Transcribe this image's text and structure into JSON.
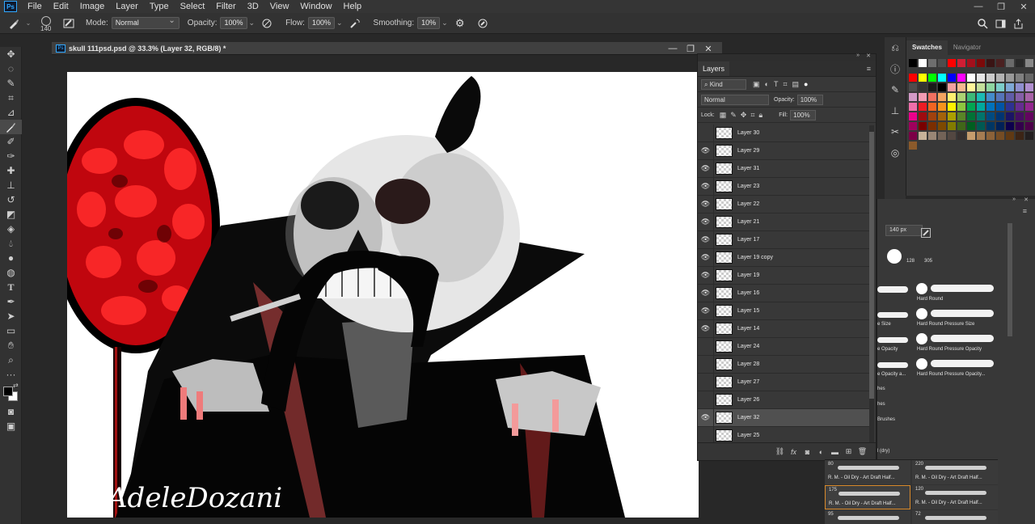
{
  "menubar": {
    "logo": "Ps",
    "items": [
      "File",
      "Edit",
      "Image",
      "Layer",
      "Type",
      "Select",
      "Filter",
      "3D",
      "View",
      "Window",
      "Help"
    ]
  },
  "options": {
    "brush_size": "140",
    "mode_label": "Mode:",
    "mode_value": "Normal",
    "opacity_label": "Opacity:",
    "opacity_value": "100%",
    "flow_label": "Flow:",
    "flow_value": "100%",
    "smoothing_label": "Smoothing:",
    "smoothing_value": "10%"
  },
  "document": {
    "title": "skull 111psd.psd @ 33.3% (Layer 32, RGB/8) *",
    "signature": "AdeleDozani"
  },
  "layers_panel": {
    "tab": "Layers",
    "kind_label": "Kind",
    "blend_mode": "Normal",
    "opacity_label": "Opacity:",
    "opacity_value": "100%",
    "lock_label": "Lock:",
    "fill_label": "Fill:",
    "fill_value": "100%",
    "layers": [
      {
        "name": "Layer 30",
        "visible": false
      },
      {
        "name": "Layer 29",
        "visible": true
      },
      {
        "name": "Layer 31",
        "visible": true
      },
      {
        "name": "Layer 23",
        "visible": true
      },
      {
        "name": "Layer 22",
        "visible": true
      },
      {
        "name": "Layer 21",
        "visible": true
      },
      {
        "name": "Layer 17",
        "visible": true
      },
      {
        "name": "Layer 19 copy",
        "visible": true
      },
      {
        "name": "Layer 19",
        "visible": true
      },
      {
        "name": "Layer 16",
        "visible": true
      },
      {
        "name": "Layer 15",
        "visible": true
      },
      {
        "name": "Layer 14",
        "visible": true
      },
      {
        "name": "Layer 24",
        "visible": false
      },
      {
        "name": "Layer 28",
        "visible": false
      },
      {
        "name": "Layer 27",
        "visible": false
      },
      {
        "name": "Layer 26",
        "visible": false
      },
      {
        "name": "Layer 32",
        "visible": true,
        "selected": true
      },
      {
        "name": "Layer 25",
        "visible": false
      }
    ]
  },
  "swatches_panel": {
    "tabs": [
      "Swatches",
      "Navigator"
    ],
    "rows": [
      [
        "#000000",
        "#ffffff",
        "#6e6e6e",
        "#4d4d4d",
        "#ff0000",
        "#d01e34",
        "#a3101c",
        "#7d0a0a",
        "#3a1414",
        "#4a2020",
        "#6a6a6a",
        "#2a2a2a",
        "#888888"
      ],
      [
        "#ff0000",
        "#ffff00",
        "#00ff00",
        "#00ffff",
        "#0000ff",
        "#ff00ff",
        "#ffffff",
        "#e6e6e6",
        "#cccccc",
        "#b3b3b3",
        "#999999",
        "#808080",
        "#666666"
      ],
      [
        "#4d4d4d",
        "#333333",
        "#1a1a1a",
        "#000000",
        "#f2a0a0",
        "#f5b98f",
        "#fff59a",
        "#c4df9b",
        "#8ed6a1",
        "#7ccdca",
        "#7ea8d6",
        "#8f8fcf",
        "#b08fcf"
      ],
      [
        "#d39ac7",
        "#f29bb3",
        "#f07060",
        "#f4a460",
        "#fff170",
        "#acd373",
        "#3cb878",
        "#1cbbb4",
        "#448ccb",
        "#5574b9",
        "#605ca8",
        "#855fa8",
        "#a763a8"
      ],
      [
        "#f06eaa",
        "#ed1c24",
        "#f26522",
        "#f7941d",
        "#fff200",
        "#8dc63f",
        "#00a651",
        "#00a99d",
        "#0072bc",
        "#0054a6",
        "#2e3192",
        "#662d91",
        "#92278f"
      ],
      [
        "#ec008c",
        "#9e0b0f",
        "#a0410d",
        "#a3620a",
        "#aba000",
        "#598527",
        "#007236",
        "#00746b",
        "#004a80",
        "#003471",
        "#1b1464",
        "#440e62",
        "#630460"
      ],
      [
        "#9e005d",
        "#790000",
        "#7b2e00",
        "#7d4900",
        "#827b00",
        "#406618",
        "#005e20",
        "#005952",
        "#003663",
        "#002157",
        "#0d004c",
        "#32004b",
        "#4b0049"
      ],
      [
        "#7b0046",
        "#c7b299",
        "#998675",
        "#736357",
        "#534741",
        "#37302f",
        "#c69c6d",
        "#a67c52",
        "#8c6239",
        "#754c24",
        "#603913",
        "#3c2415",
        "#231f20"
      ],
      [
        "#8b5a2b"
      ]
    ]
  },
  "brushes_panel": {
    "size": "140 px",
    "preset_sizes": [
      "128",
      "305"
    ],
    "items": [
      {
        "label": "Hard Round"
      },
      {
        "label": "e Size"
      },
      {
        "label": "Hard Round Pressure Size"
      },
      {
        "label": "e Opacity"
      },
      {
        "label": "Hard Round Pressure Opacity"
      },
      {
        "label": "e Opacity a..."
      },
      {
        "label": "Hard Round Pressure Opacity..."
      }
    ],
    "groups": [
      "hes",
      "hes",
      "Brushes",
      "l (dry)"
    ]
  },
  "brush_strip": {
    "cells": [
      {
        "num": "80",
        "name": "R. M. - Oil Dry - Art Draft Half..."
      },
      {
        "num": "220",
        "name": "R. M. - Oil Dry - Art Draft Half..."
      },
      {
        "num": "175",
        "name": "R. M. - Oil Dry - Art Draft Half...",
        "selected": true
      },
      {
        "num": "120",
        "name": "R. M. - Oil Dry - Art Draft Half..."
      },
      {
        "num": "95",
        "name": ""
      },
      {
        "num": "72",
        "name": ""
      }
    ]
  },
  "colors": {
    "accent": "#d98a2b",
    "ps_blue": "#31a8ff",
    "painting_red": "#e0101a"
  }
}
